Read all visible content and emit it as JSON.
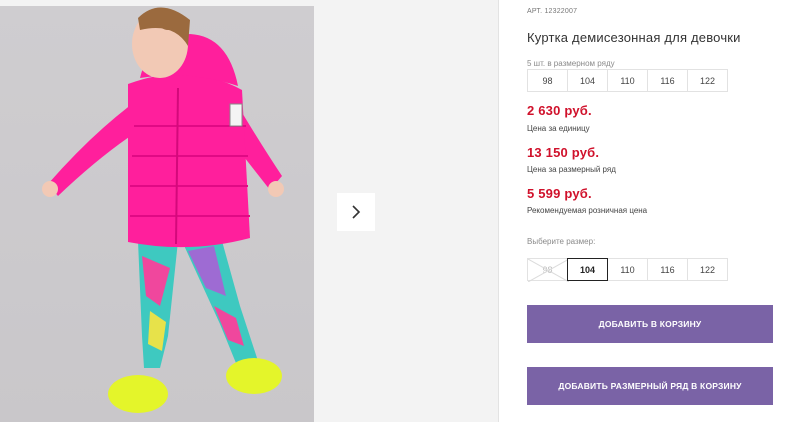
{
  "product": {
    "sku_label": "АРТ.",
    "sku": "12322007",
    "title": "Куртка демисезонная для девочки"
  },
  "pack": {
    "note": "5 шт. в размерном ряду",
    "sizes": [
      "98",
      "104",
      "110",
      "116",
      "122"
    ]
  },
  "prices": {
    "unit_price": "2 630 руб.",
    "unit_label": "Цена за единицу",
    "pack_price": "13 150 руб.",
    "pack_label": "Цена за размерный ряд",
    "retail_price": "5 599 руб.",
    "retail_label": "Рекомендуемая розничная цена",
    "accent_color": "#d0112b"
  },
  "size_select": {
    "label": "Выберите размер:",
    "sizes": [
      "98",
      "104",
      "110",
      "116",
      "122"
    ],
    "selected": "104",
    "unavailable": "98"
  },
  "actions": {
    "add_to_cart": "ДОБАВИТЬ В КОРЗИНУ",
    "add_pack_to_cart": "ДОБАВИТЬ РАЗМЕРНЫЙ РЯД В КОРЗИНУ",
    "button_color": "#7a63a6"
  },
  "gallery": {
    "next_icon": "chevron-right-icon"
  }
}
